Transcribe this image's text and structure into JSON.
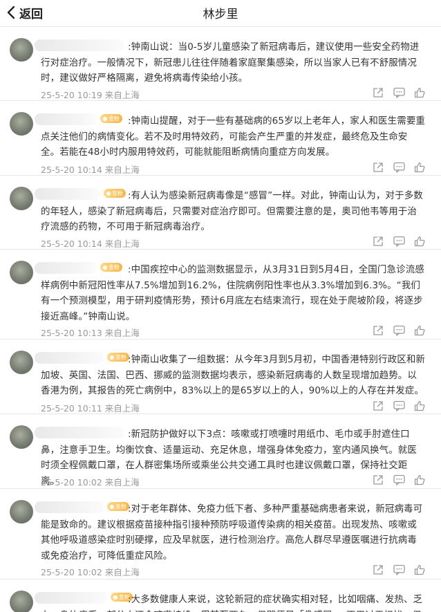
{
  "header": {
    "back_label": "返回",
    "title": "林步里"
  },
  "comments": [
    {
      "text": ":钟南山说：当0-5岁儿童感染了新冠病毒后，建议使用一些安全药物进行对症治疗。一般情况下，新冠患儿往往伴随着家庭聚集感染，所以当家人已有不舒服情况时，建议做好严格隔离，避免将病毒传染给小孩。",
      "time": "25-5-20 10:19",
      "location": "来自上海",
      "badge": ""
    },
    {
      "text": ":钟南山提醒，对于一些有基础病的65岁以上老年人，家人和医生需要重点关注他们的病情变化。若不及时用特效药，可能会产生严重的并发症，最终危及生命安全。若能在48小时内服用特效药，可能就能阻断病情向重症方向发展。",
      "time": "25-5-20 10:14",
      "location": "来自上海",
      "badge": "金粉"
    },
    {
      "text": ":有人认为感染新冠病毒像是“感冒”一样。对此，钟南山认为，对于多数的年轻人，感染了新冠病毒后，只需要对症治疗即可。但需要注意的是，奥司他韦等用于治疗流感的药物，不可用于新冠病毒治疗。",
      "time": "25-5-20 10:14",
      "location": "来自上海",
      "badge": "金粉"
    },
    {
      "text": ":中国疾控中心的监测数据显示，从3月31日到5月4日，全国门急诊流感样病例中新冠阳性率从7.5%增加到16.2%，住院病例阳性率也从3.3%增加到6.3%。“我们有一个预测模型，用于研判疫情形势，预计6月底左右结束流行，现在处于爬坡阶段，将逐步接近高峰。”钟南山说。",
      "time": "25-5-20 10:13",
      "location": "来自上海",
      "badge": "金粉"
    },
    {
      "text": ":钟南山收集了一组数据：从今年3月到5月初，中国香港特别行政区和新加坡、英国、法国、巴西、挪威的监测数据均表示，感染新冠病毒的人数呈现增加趋势。以香港为例，其报告的死亡病例中，83%以上的是65岁以上的人，90%以上的人存在并发症。",
      "time": "25-5-20 10:11",
      "location": "来自上海",
      "badge": "金粉"
    },
    {
      "text": ":新冠防护做好以下3点：咳嗽或打喷嚏时用纸巾、毛巾或手肘遮住口鼻，注意手卫生。均衡饮食、适量运动、充足休息，增强身体免疫力，室内通风换气。就医时须全程佩戴口罩，在人群密集场所或乘坐公共交通工具时也建议佩戴口罩，保持社交距离。",
      "time": "25-5-20 10:02",
      "location": "来自上海",
      "badge": ""
    },
    {
      "text": ":对于老年群体、免疫力低下者、多种严重基础病患者来说，新冠病毒可能是致命的。建议根据疫苗接种指引接种预防呼吸道传染病的相关疫苗。出现发热、咳嗽或其他呼吸道感染症时别硬撑，应及早就医，进行检测治疗。高危人群尽早遵医嘱进行抗病毒或免疫治疗，可降低重症风险。",
      "time": "25-5-20 10:02",
      "location": "来自上海",
      "badge": "金粉"
    },
    {
      "text": ":大多数健康人来说，这轮新冠的症状确实相对轻，比如咽痛、发热、乏力，身体疲乏，部分人还会咳嗽持续一周甚至两久。但即便是「像感冒」，不用过于担忧，但也",
      "time": "",
      "location": "",
      "badge": "金粉"
    }
  ],
  "colors": {
    "meta": "#999999",
    "badge": "#f5b548",
    "divider": "#e6e6e6"
  },
  "icons": [
    "back-chevron-icon",
    "share-icon",
    "comment-icon",
    "like-icon"
  ]
}
